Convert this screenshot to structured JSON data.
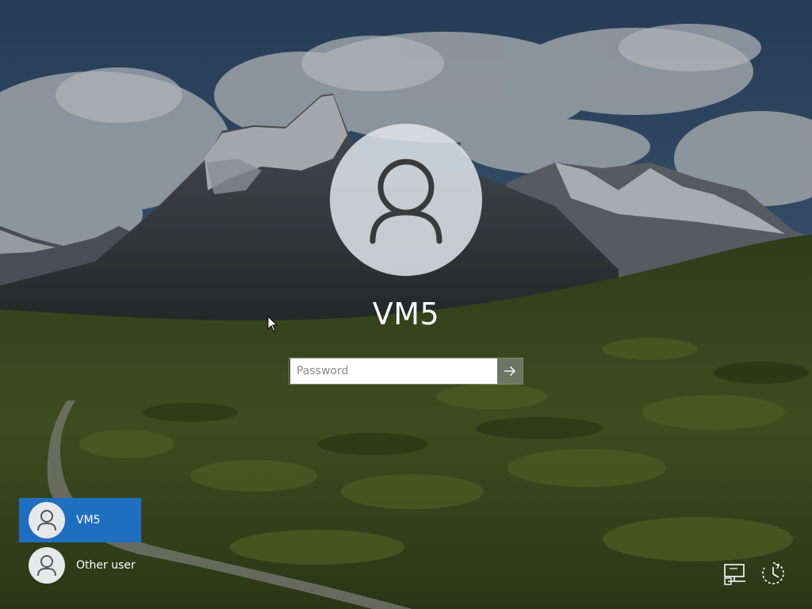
{
  "screen": {
    "type": "windows-lock-screen"
  },
  "account": {
    "username": "VM5"
  },
  "password_field": {
    "placeholder": "Password",
    "value": ""
  },
  "user_list": [
    {
      "label": "VM5",
      "selected": true
    },
    {
      "label": "Other user",
      "selected": false
    }
  ],
  "corner_icons": [
    "network-icon",
    "accessibility-icon"
  ],
  "colors": {
    "selected_user_bg": "#1e6fc0",
    "text": "#ffffff"
  }
}
